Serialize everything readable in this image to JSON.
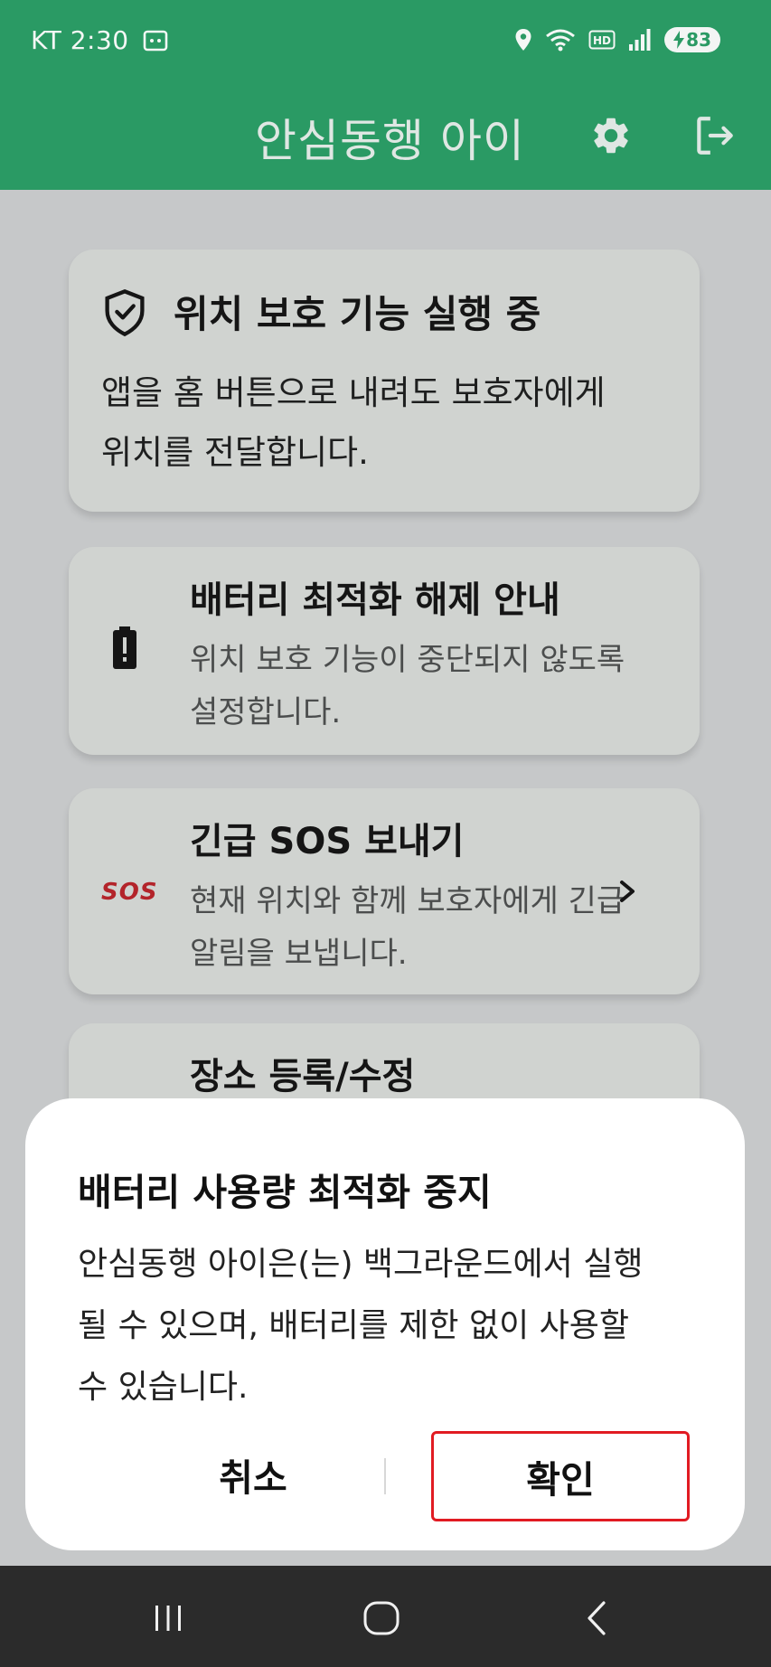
{
  "status_bar": {
    "carrier_time": "KT 2:30",
    "battery_level": "83"
  },
  "app_bar": {
    "title": "안심동행 아이",
    "icons": [
      "gear-icon",
      "logout-icon"
    ]
  },
  "cards": {
    "protection": {
      "title": "위치 보호 기능 실행 중",
      "description": "앱을 홈 버튼으로 내려도 보호자에게 위치를 전달합니다.",
      "icon": "shield-check-icon"
    },
    "battery": {
      "title": "배터리 최적화 해제 안내",
      "description": "위치 보호 기능이 중단되지 않도록 설정합니다.",
      "icon": "battery-alert-icon"
    },
    "sos": {
      "title": "긴급 SOS 보내기",
      "description": "현재 위치와 함께 보호자에게 긴급 알림을 보냅니다.",
      "icon_text": "SOS"
    },
    "places": {
      "title": "장소 등록/수정"
    }
  },
  "dialog": {
    "title": "배터리 사용량 최적화 중지",
    "body": "안심동행 아이은(는) 백그라운드에서 실행될 수 있으며, 배터리를 제한 없이 사용할 수 있습니다.",
    "cancel_label": "취소",
    "confirm_label": "확인"
  },
  "colors": {
    "app_bar": "#2a9a64",
    "highlight_border": "#e11b22",
    "sos_red": "#b3242a"
  }
}
